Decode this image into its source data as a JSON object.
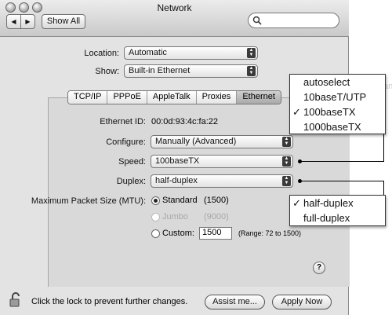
{
  "window": {
    "title": "Network"
  },
  "toolbar": {
    "back_label": "◀",
    "forward_label": "▶",
    "show_all_label": "Show All",
    "search_value": ""
  },
  "location": {
    "label": "Location:",
    "value": "Automatic"
  },
  "show": {
    "label": "Show:",
    "value": "Built-in Ethernet"
  },
  "tabs": [
    {
      "label": "TCP/IP"
    },
    {
      "label": "PPPoE"
    },
    {
      "label": "AppleTalk"
    },
    {
      "label": "Proxies"
    },
    {
      "label": "Ethernet",
      "selected": true
    }
  ],
  "ethernet": {
    "id_label": "Ethernet ID:",
    "id_value": "00:0d:93:4c:fa:22",
    "configure_label": "Configure:",
    "configure_value": "Manually (Advanced)",
    "speed_label": "Speed:",
    "speed_value": "100baseTX",
    "duplex_label": "Duplex:",
    "duplex_value": "half-duplex",
    "mtu_label": "Maximum Packet Size (MTU):",
    "mtu_standard_label": "Standard",
    "mtu_standard_value": "(1500)",
    "mtu_jumbo_label": "Jumbo",
    "mtu_jumbo_value": "(9000)",
    "mtu_custom_label": "Custom:",
    "mtu_custom_value": "1500",
    "mtu_range": "(Range: 72 to 1500)"
  },
  "help_label": "?",
  "footer": {
    "lock_text": "Click the lock to prevent further changes.",
    "assist_label": "Assist me...",
    "apply_label": "Apply Now"
  },
  "speed_menu": {
    "options": [
      "autoselect",
      "10baseT/UTP",
      "100baseTX",
      "1000baseTX"
    ],
    "checked": "100baseTX",
    "check_mark": "✓",
    "behind_text": "Advanced"
  },
  "duplex_menu": {
    "options": [
      "half-duplex",
      "full-duplex"
    ],
    "checked": "half-duplex",
    "check_mark": "✓"
  }
}
